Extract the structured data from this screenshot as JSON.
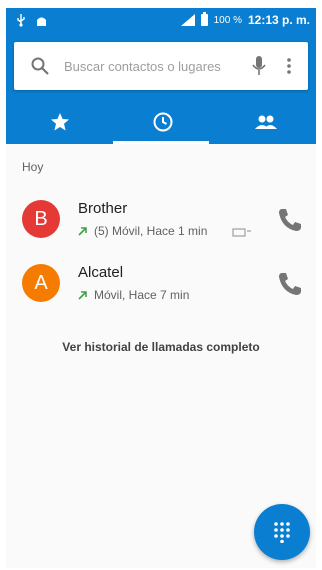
{
  "statusbar": {
    "battery_percent": "100 %",
    "time": "12:13 p. m."
  },
  "search": {
    "placeholder": "Buscar contactos o lugares"
  },
  "tabs": [
    {
      "name": "favorites",
      "icon": "star-icon",
      "selected": false
    },
    {
      "name": "recents",
      "icon": "clock-icon",
      "selected": true
    },
    {
      "name": "contacts",
      "icon": "people-icon",
      "selected": false
    }
  ],
  "section": {
    "label": "Hoy"
  },
  "calls": [
    {
      "initial": "B",
      "name": "Brother",
      "detail": "(5) Móvil, Hace 1 min",
      "avatar_color": "#e53935",
      "has_voicemail": true
    },
    {
      "initial": "A",
      "name": "Alcatel",
      "detail": "Móvil, Hace 7 min",
      "avatar_color": "#f57c00",
      "has_voicemail": false
    }
  ],
  "history_link": "Ver historial de llamadas completo",
  "colors": {
    "accent": "#0a7fd1",
    "outgoing_arrow": "#43a047"
  }
}
